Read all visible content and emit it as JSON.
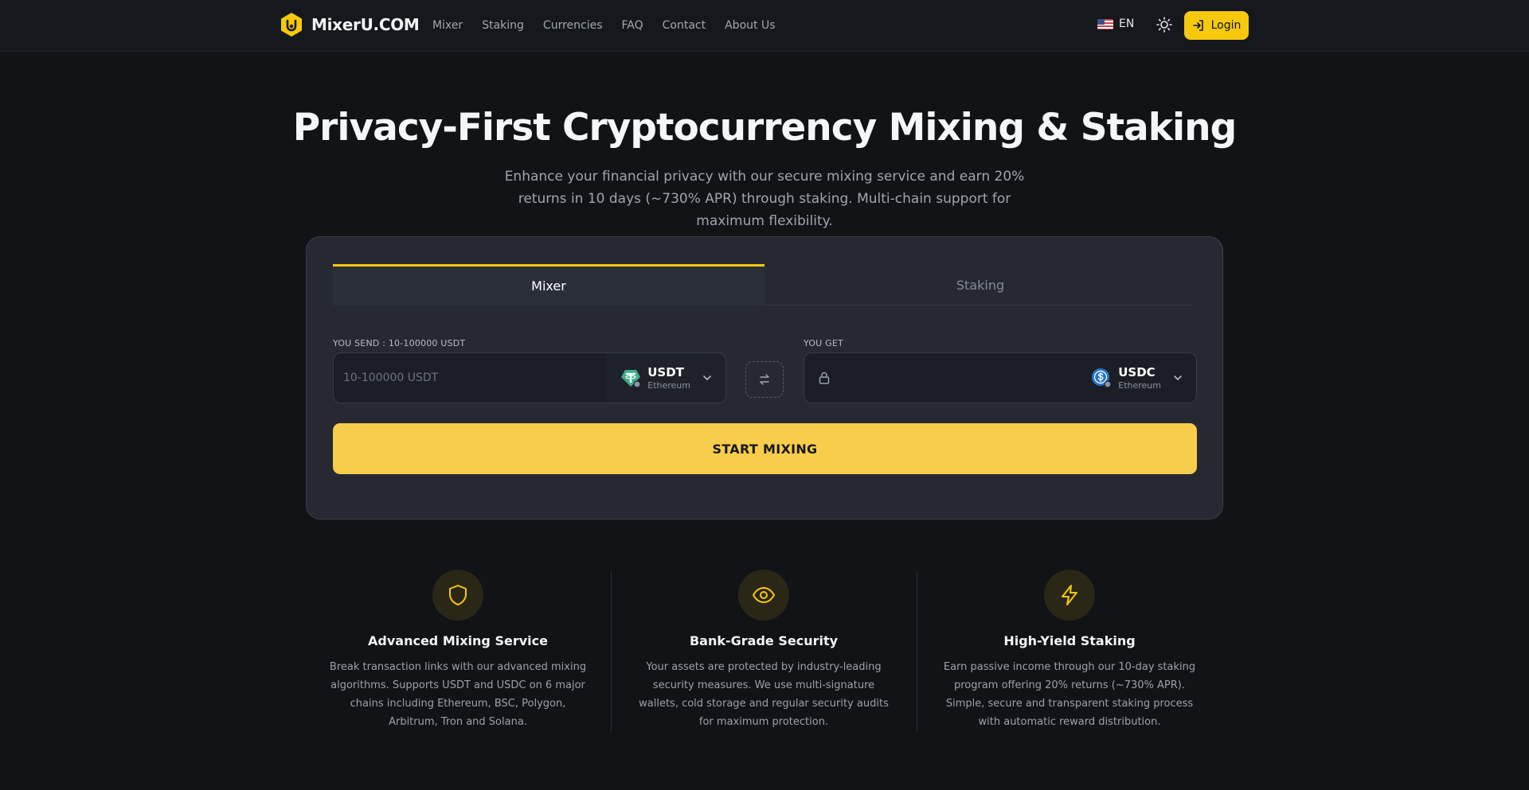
{
  "brand": {
    "name": "MixerU.COM"
  },
  "nav": {
    "links": [
      "Mixer",
      "Staking",
      "Currencies",
      "FAQ",
      "Contact",
      "About Us"
    ],
    "language": "EN",
    "login_label": "Login"
  },
  "hero": {
    "title": "Privacy-First Cryptocurrency Mixing & Staking",
    "subtitle": "Enhance your financial privacy with our secure mixing service and earn 20% returns in 10 days (~730% APR) through staking. Multi-chain support for maximum flexibility."
  },
  "card": {
    "tabs": [
      {
        "label": "Mixer",
        "active": true
      },
      {
        "label": "Staking",
        "active": false
      }
    ],
    "send": {
      "label": "YOU SEND : 10-100000 USDT",
      "placeholder": "10-100000 USDT",
      "currency": "USDT",
      "chain": "Ethereum"
    },
    "get": {
      "label": "YOU GET",
      "currency": "USDC",
      "chain": "Ethereum"
    },
    "start_label": "START MIXING"
  },
  "features": [
    {
      "icon": "shield-icon",
      "title": "Advanced Mixing Service",
      "description": "Break transaction links with our advanced mixing algorithms. Supports USDT and USDC on 6 major chains including Ethereum, BSC, Polygon, Arbitrum, Tron and Solana."
    },
    {
      "icon": "eye-icon",
      "title": "Bank-Grade Security",
      "description": "Your assets are protected by industry-leading security measures. We use multi-signature wallets, cold storage and regular security audits for maximum protection."
    },
    {
      "icon": "lightning-icon",
      "title": "High-Yield Staking",
      "description": "Earn passive income through our 10-day staking program offering 20% returns (~730% APR). Simple, secure and transparent staking process with automatic reward distribution."
    }
  ],
  "colors": {
    "background": "#111317",
    "accent": "#f6c90e",
    "button": "#f8cd4b",
    "card": "#262932"
  }
}
